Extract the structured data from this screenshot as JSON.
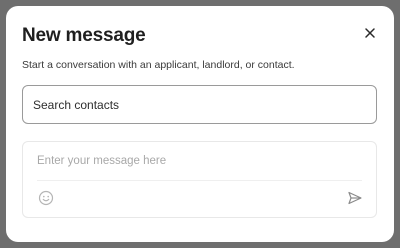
{
  "modal": {
    "title": "New message",
    "subtitle": "Start a conversation with an applicant, landlord, or contact.",
    "close_icon": "close-icon"
  },
  "search": {
    "value": "",
    "placeholder": "Search contacts"
  },
  "composer": {
    "value": "",
    "placeholder": "Enter your message here",
    "emoji_icon": "smiley-face-icon",
    "send_icon": "send-icon"
  }
}
